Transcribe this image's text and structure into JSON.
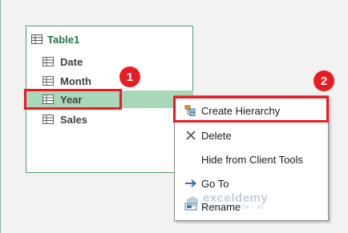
{
  "table": {
    "name": "Table1",
    "fields": [
      {
        "label": "Date",
        "selected": false
      },
      {
        "label": "Month",
        "selected": false
      },
      {
        "label": "Year",
        "selected": true
      },
      {
        "label": "Sales",
        "selected": false
      }
    ]
  },
  "callouts": [
    "1",
    "2"
  ],
  "context_menu": {
    "items": [
      {
        "label": "Create Hierarchy",
        "icon": "hierarchy-icon"
      },
      {
        "label": "Delete",
        "icon": "x-icon"
      },
      {
        "label": "Hide from Client Tools",
        "icon": ""
      },
      {
        "label": "Go To",
        "icon": "arrow-right-icon"
      },
      {
        "label": "Rename",
        "icon": "rename-icon"
      }
    ]
  },
  "watermark": {
    "name": "exceldemy",
    "tagline": "EXCEL · DATA · BI"
  },
  "colors": {
    "accent_green": "#217346",
    "selection": "#a9d8b8",
    "highlight_red": "#e81c24"
  }
}
